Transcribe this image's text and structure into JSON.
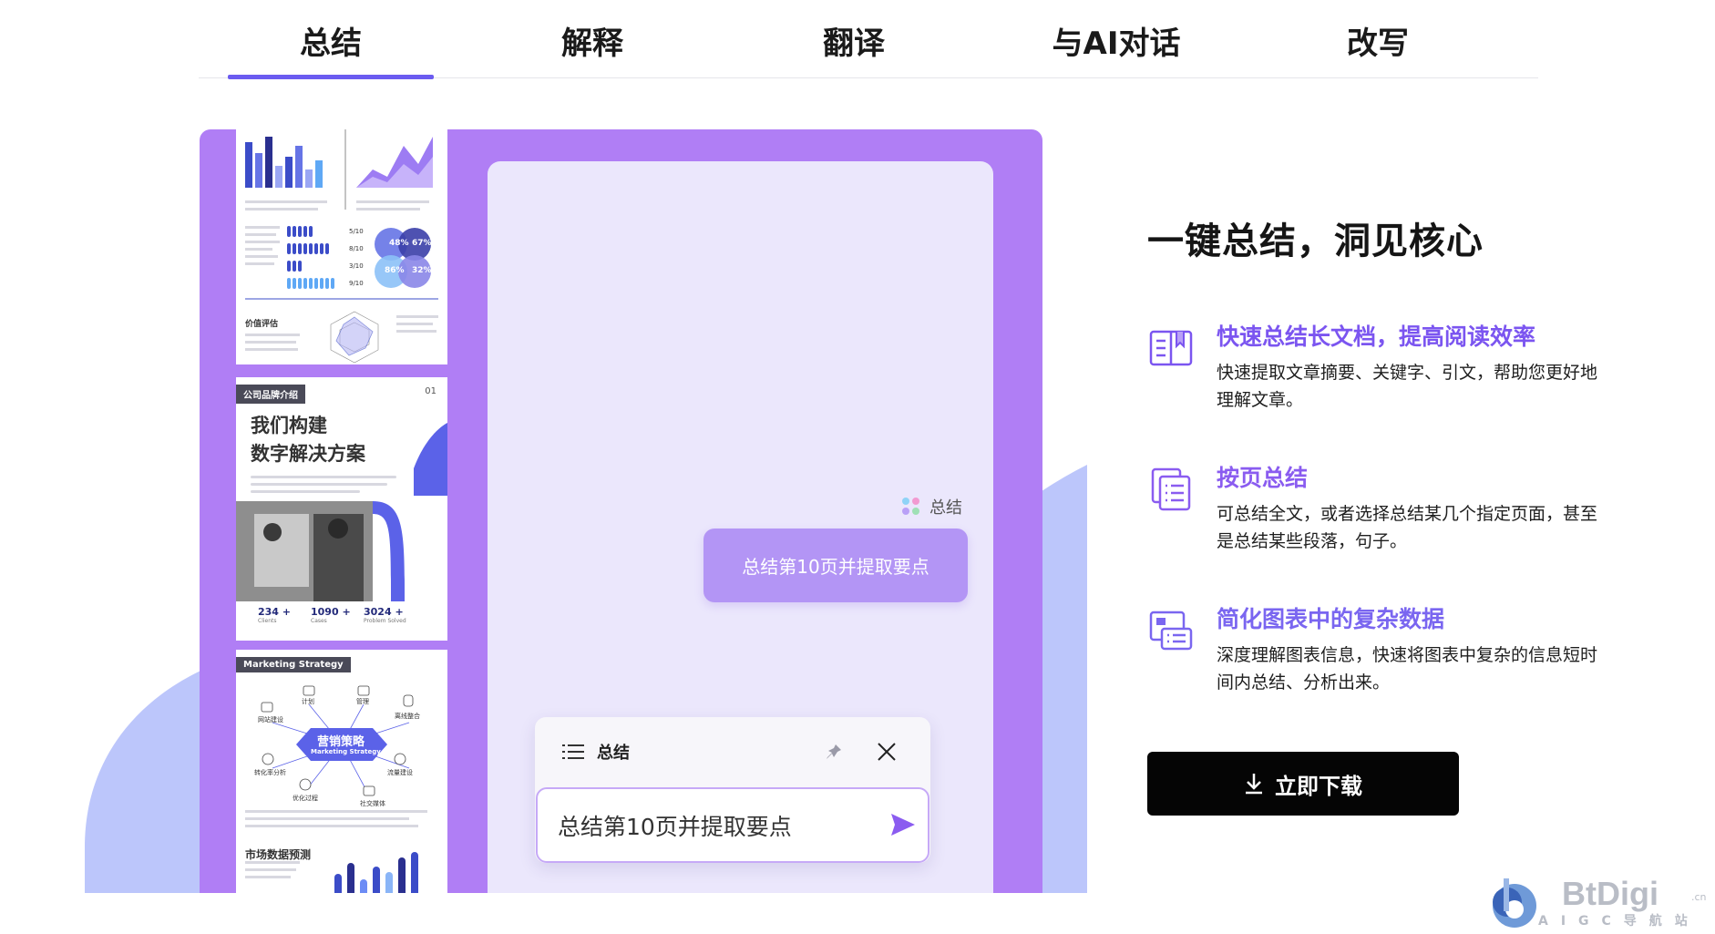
{
  "tabs": [
    {
      "label": "总结",
      "active": true
    },
    {
      "label": "解释",
      "active": false
    },
    {
      "label": "翻译",
      "active": false
    },
    {
      "label": "与AI对话",
      "active": false
    },
    {
      "label": "改写",
      "active": false
    }
  ],
  "illustration": {
    "doc_card_2": {
      "tag": "公司品牌介绍",
      "number": "01",
      "title_line1": "我们构建",
      "title_line2": "数字解决方案",
      "stats": [
        {
          "value": "234 +",
          "label": "Clients"
        },
        {
          "value": "1090 +",
          "label": "Cases"
        },
        {
          "value": "3024 +",
          "label": "Problem Solved"
        }
      ]
    },
    "doc_card_1": {
      "section_label": "价值评估",
      "percents": [
        "48%",
        "67%",
        "86%",
        "32%"
      ],
      "ratios": [
        "5/10",
        "8/10",
        "3/10",
        "9/10"
      ]
    },
    "doc_card_3": {
      "tag": "Marketing Strategy",
      "center_title": "营销策略",
      "center_sub": "Marketing Strategy",
      "nodes": [
        "计划",
        "管理",
        "网站建设",
        "离线整合",
        "转化率分析",
        "流量建设",
        "优化过程",
        "社交媒体"
      ],
      "bottom_title": "市场数据预测"
    },
    "assistant_label": "总结",
    "user_bubble": "总结第10页并提取要点",
    "composer": {
      "title": "总结",
      "input_value": "总结第10页并提取要点"
    }
  },
  "headline": "一键总结，洞见核心",
  "features": [
    {
      "title": "快速总结长文档，提高阅读效率",
      "desc": "快速提取文章摘要、关键字、引文，帮助您更好地理解文章。",
      "icon": "book-icon"
    },
    {
      "title": "按页总结",
      "desc": "可总结全文，或者选择总结某几个指定页面，甚至是总结某些段落，句子。",
      "icon": "pages-icon"
    },
    {
      "title": "简化图表中的复杂数据",
      "desc": "深度理解图表信息，快速将图表中复杂的信息短时间内总结、分析出来。",
      "icon": "chart-doc-icon"
    }
  ],
  "download_label": "立即下载",
  "watermark": {
    "brand": "BtDigi",
    "sub": "AIGC导航站",
    "tld": ".cn"
  },
  "colors": {
    "accent": "#6b5bf0",
    "panel": "#b07ef5",
    "chat_bg": "#ebe7fc",
    "bubble": "#b395f5",
    "button": "#050505"
  }
}
